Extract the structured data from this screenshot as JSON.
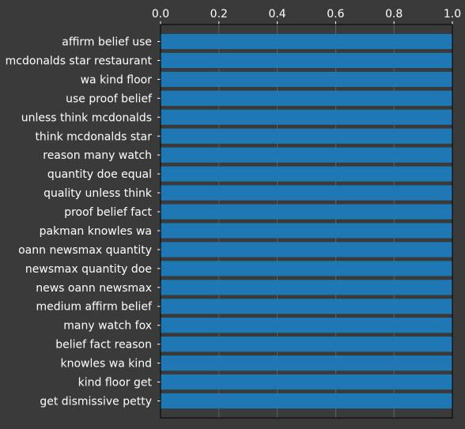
{
  "chart_data": {
    "type": "bar",
    "orientation": "horizontal",
    "categories": [
      "affirm belief use",
      "mcdonalds star restaurant",
      "wa kind floor",
      "use proof belief",
      "unless think mcdonalds",
      "think mcdonalds star",
      "reason many watch",
      "quantity doe equal",
      "quality unless think",
      "proof belief fact",
      "pakman knowles wa",
      "oann newsmax quantity",
      "newsmax quantity doe",
      "news oann newsmax",
      "medium affirm belief",
      "many watch fox",
      "belief fact reason",
      "knowles wa kind",
      "kind floor get",
      "get dismissive petty"
    ],
    "values": [
      1.0,
      1.0,
      1.0,
      1.0,
      1.0,
      1.0,
      1.0,
      1.0,
      1.0,
      1.0,
      1.0,
      1.0,
      1.0,
      1.0,
      1.0,
      1.0,
      1.0,
      1.0,
      1.0,
      1.0
    ],
    "xlim": [
      0,
      1.0
    ],
    "x_ticks": [
      "0.0",
      "0.2",
      "0.4",
      "0.6",
      "0.8",
      "1.0"
    ],
    "x_axis_position": "top",
    "grid": true,
    "colors": {
      "background": "#3a3a3a",
      "plot_background": "#3a3a3a",
      "bar": "#1f77b4",
      "grid": "#6a6a6a",
      "text": "#ffffff",
      "axis": "#000000"
    }
  }
}
